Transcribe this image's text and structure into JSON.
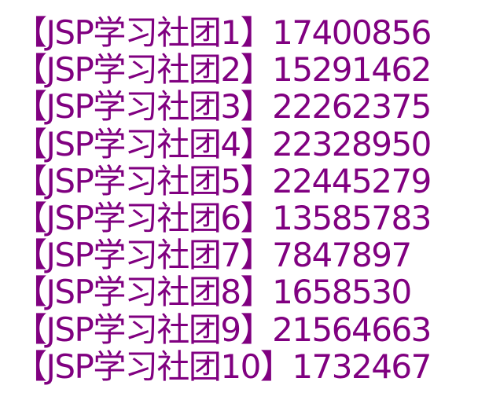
{
  "text_color": "#800080",
  "background": "#ffffff",
  "entries": [
    {
      "name": "【JSP学习社团1】",
      "number": "17400856"
    },
    {
      "name": "【JSP学习社团2】",
      "number": "15291462"
    },
    {
      "name": "【JSP学习社团3】",
      "number": "22262375"
    },
    {
      "name": "【JSP学习社团4】",
      "number": "22328950"
    },
    {
      "name": "【JSP学习社团5】",
      "number": "22445279"
    },
    {
      "name": "【JSP学习社团6】",
      "number": "13585783"
    },
    {
      "name": "【JSP学习社团7】",
      "number": "7847897"
    },
    {
      "name": "【JSP学习社团8】",
      "number": "1658530"
    },
    {
      "name": "【JSP学习社团9】",
      "number": "21564663"
    },
    {
      "name": "【JSP学习社团10】",
      "number": "1732467"
    }
  ]
}
